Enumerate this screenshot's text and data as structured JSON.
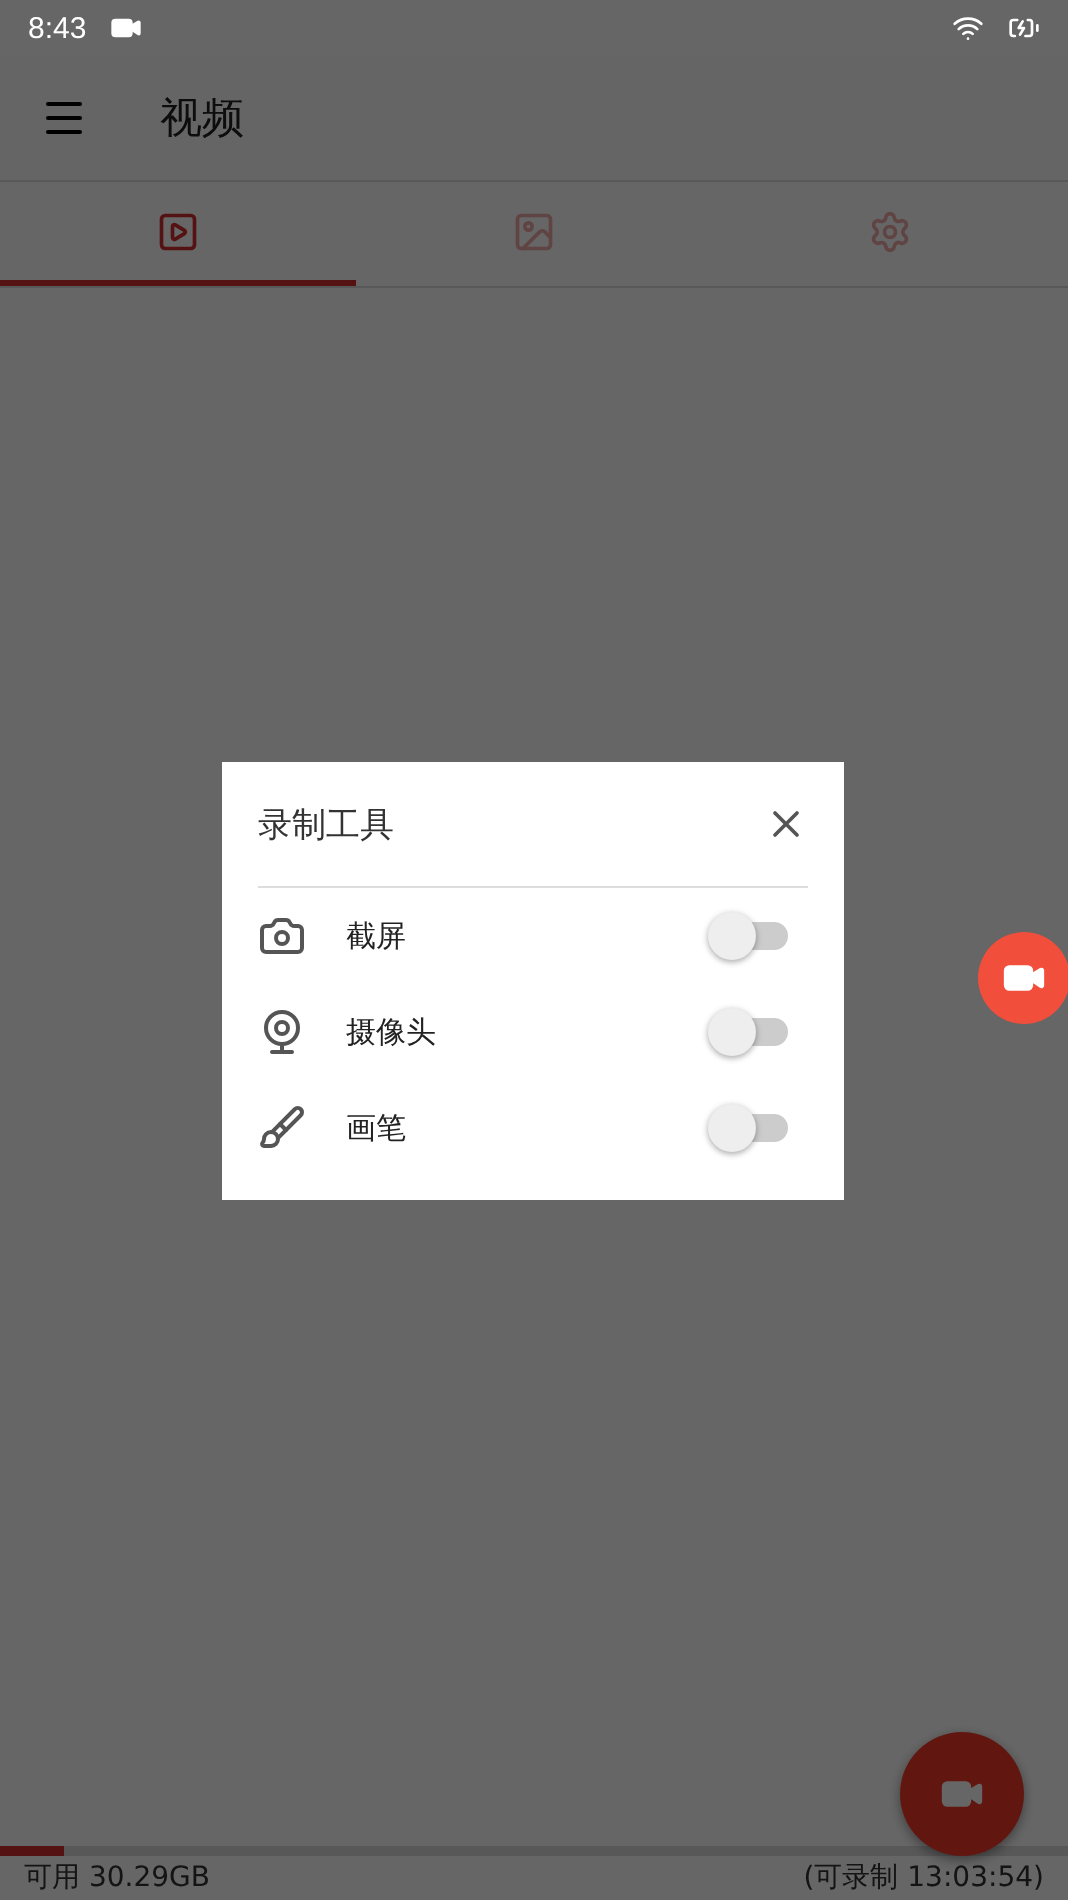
{
  "status_bar": {
    "time": "8:43"
  },
  "app_bar": {
    "title": "视频"
  },
  "tabs": [
    {
      "kind": "video",
      "selected": true
    },
    {
      "kind": "image",
      "selected": false
    },
    {
      "kind": "settings",
      "selected": false
    }
  ],
  "storage": {
    "level": 0.06,
    "available": "可用 30.29GB",
    "recordable": "(可录制 13:03:54)"
  },
  "dialog": {
    "title": "录制工具",
    "items": [
      {
        "kind": "camera",
        "label": "截屏",
        "on": false
      },
      {
        "kind": "webcam",
        "label": "摄像头",
        "on": false
      },
      {
        "kind": "brush",
        "label": "画笔",
        "on": false
      }
    ]
  }
}
